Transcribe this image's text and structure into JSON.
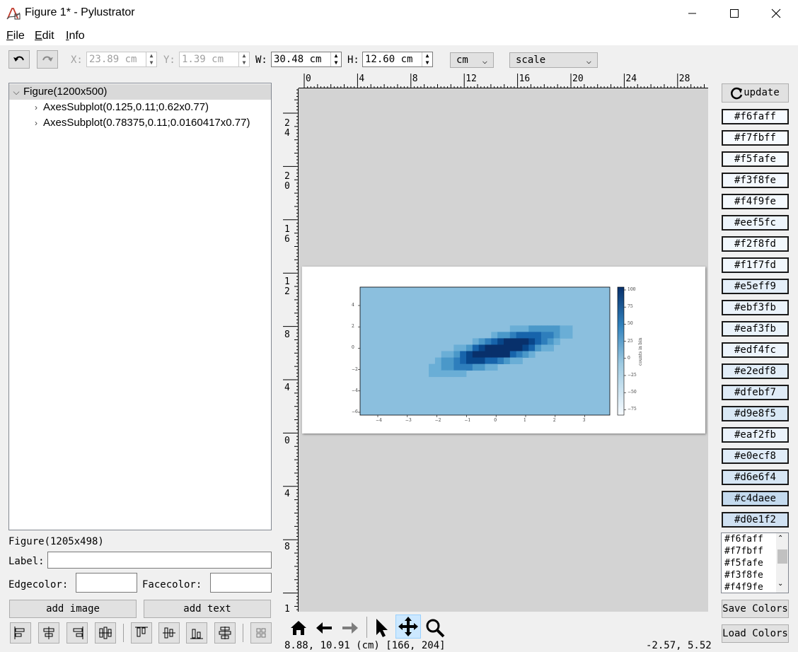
{
  "window": {
    "title": "Figure 1* - Pylustrator"
  },
  "menu": [
    {
      "key": "F",
      "rest": "ile"
    },
    {
      "key": "E",
      "rest": "dit"
    },
    {
      "key": "I",
      "rest": "nfo"
    }
  ],
  "toolbar": {
    "x_label": "X:",
    "x_value": "23.89 cm",
    "y_label": "Y:",
    "y_value": "1.39 cm",
    "w_label": "W:",
    "w_value": "30.48 cm",
    "h_label": "H:",
    "h_value": "12.60 cm",
    "unit": "cm",
    "mode": "scale"
  },
  "tree": {
    "root": "Figure(1200x500)",
    "children": [
      "AxesSubplot(0.125,0.11;0.62x0.77)",
      "AxesSubplot(0.78375,0.11;0.0160417x0.77)"
    ]
  },
  "props": {
    "figure_info": "Figure(1205x498)",
    "label_label": "Label:",
    "edgecolor_label": "Edgecolor:",
    "facecolor_label": "Facecolor:",
    "add_image": "add image",
    "add_text": "add text"
  },
  "ruler": {
    "top": [
      "0",
      "4",
      "8",
      "12",
      "16",
      "20",
      "24",
      "28"
    ],
    "left": [
      [
        "2",
        "4"
      ],
      [
        "2",
        "0"
      ],
      [
        "1",
        "6"
      ],
      [
        "1",
        "2"
      ],
      [
        "8"
      ],
      [
        "4"
      ],
      [
        "0"
      ],
      [
        "4"
      ],
      [
        "8"
      ],
      [
        "1"
      ]
    ]
  },
  "plot": {
    "xticks": [
      "−4",
      "−3",
      "−2",
      "−1",
      "0",
      "1",
      "2",
      "3"
    ],
    "yticks": [
      "4",
      "2",
      "0",
      "−2",
      "−4",
      "−6"
    ],
    "cbar_ticks": [
      "100",
      "75",
      "50",
      "25",
      "0",
      "−25",
      "−50",
      "−75"
    ],
    "cbar_label": "counts in bin"
  },
  "status": {
    "left": "8.88, 10.91 (cm) [166, 204]",
    "right": "-2.57, 5.52"
  },
  "right_panel": {
    "update": "update",
    "colors": [
      "#f6faff",
      "#f7fbff",
      "#f5fafe",
      "#f3f8fe",
      "#f4f9fe",
      "#eef5fc",
      "#f2f8fd",
      "#f1f7fd",
      "#e5eff9",
      "#ebf3fb",
      "#eaf3fb",
      "#edf4fc",
      "#e2edf8",
      "#dfebf7",
      "#d9e8f5",
      "#eaf2fb",
      "#e0ecf8",
      "#d6e6f4",
      "#c4daee",
      "#d0e1f2"
    ],
    "color_list": [
      "#f6faff",
      "#f7fbff",
      "#f5fafe",
      "#f3f8fe",
      "#f4f9fe"
    ],
    "save_colors": "Save Colors",
    "load_colors": "Load Colors"
  }
}
